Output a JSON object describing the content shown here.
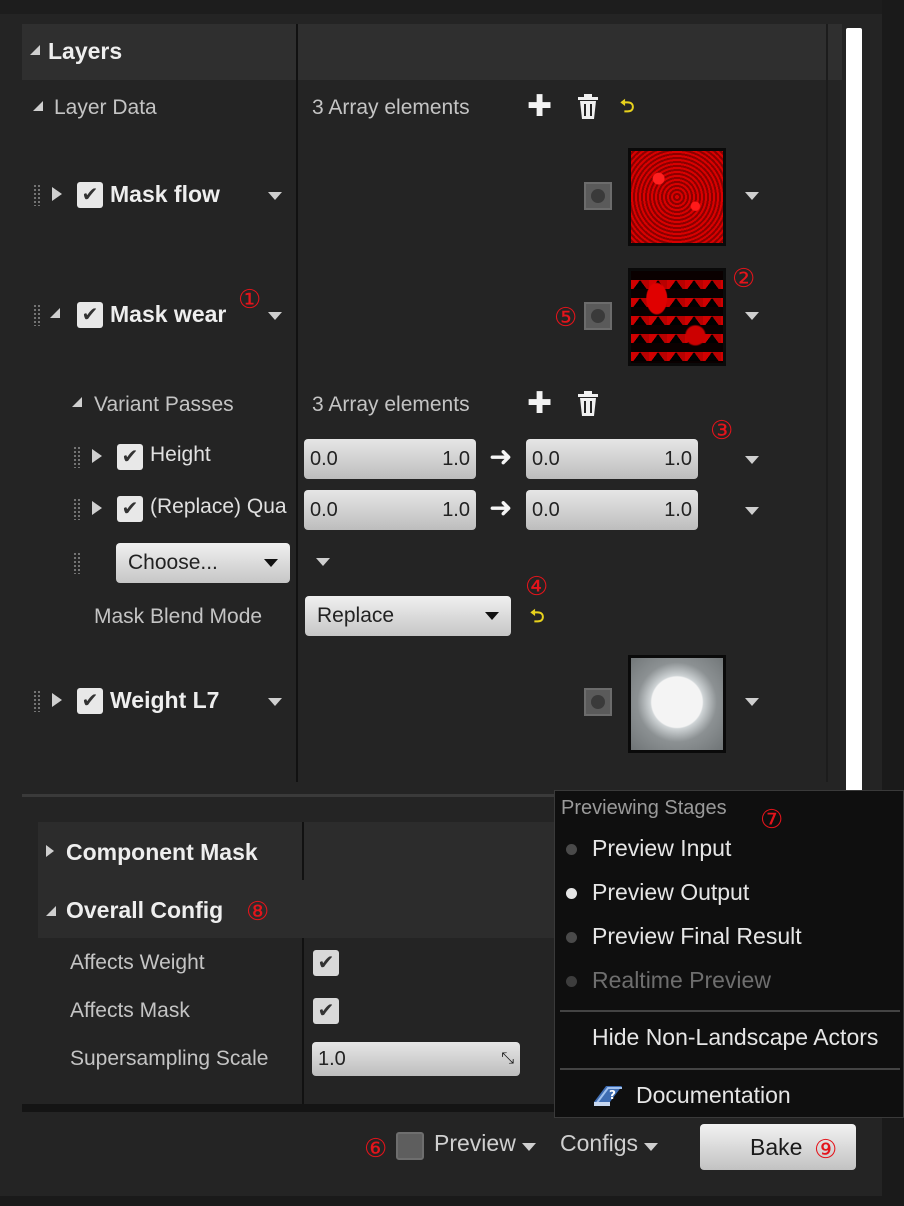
{
  "layers": {
    "section_title": "Layers",
    "layer_data_label": "Layer Data",
    "layer_data_count": "3 Array elements",
    "items": [
      {
        "label": "Mask flow"
      },
      {
        "label": "Mask wear"
      },
      {
        "label": "Weight L7"
      }
    ],
    "variant_passes_label": "Variant Passes",
    "variant_passes_count": "3 Array elements",
    "passes": [
      {
        "label": "Height",
        "min1": "0.0",
        "max1": "1.0",
        "min2": "0.0",
        "max2": "1.0"
      },
      {
        "label": "(Replace) Qua",
        "min1": "0.0",
        "max1": "1.0",
        "min2": "0.0",
        "max2": "1.0"
      }
    ],
    "choose_label": "Choose...",
    "mask_blend_mode_label": "Mask Blend Mode",
    "mask_blend_mode_value": "Replace"
  },
  "component_mask": {
    "title": "Component Mask"
  },
  "overall_config": {
    "title": "Overall Config",
    "affects_weight_label": "Affects Weight",
    "affects_mask_label": "Affects Mask",
    "supersampling_label": "Supersampling Scale",
    "supersampling_value": "1.0"
  },
  "previewing_menu": {
    "title": "Previewing Stages",
    "options": [
      "Preview Input",
      "Preview Output",
      "Preview Final Result",
      "Realtime Preview"
    ],
    "selected": "Preview Output",
    "hide_actors": "Hide Non-Landscape Actors",
    "documentation": "Documentation"
  },
  "footer": {
    "preview_label": "Preview",
    "configs_label": "Configs",
    "bake_label": "Bake"
  },
  "annotations": [
    "①",
    "②",
    "③",
    "④",
    "⑤",
    "⑥",
    "⑦",
    "⑧",
    "⑨"
  ],
  "colors": {
    "annotation": "#e4141b",
    "reset_icon": "#e8d21d",
    "texture_red": "#d90000"
  }
}
